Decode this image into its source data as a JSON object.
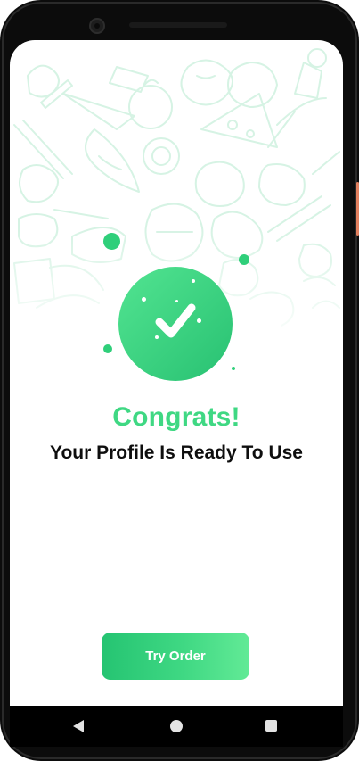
{
  "success": {
    "title": "Congrats!",
    "message": "Your Profile Is Ready To Use",
    "icon": "check-icon"
  },
  "actions": {
    "try_order_label": "Try Order"
  },
  "nav": {
    "back_icon": "back-triangle-icon",
    "home_icon": "home-circle-icon",
    "recent_icon": "recent-square-icon"
  },
  "colors": {
    "accent": "#3fd883",
    "accent_dark": "#25c472",
    "pattern": "#d6f3e4",
    "text": "#0e0e0e"
  }
}
